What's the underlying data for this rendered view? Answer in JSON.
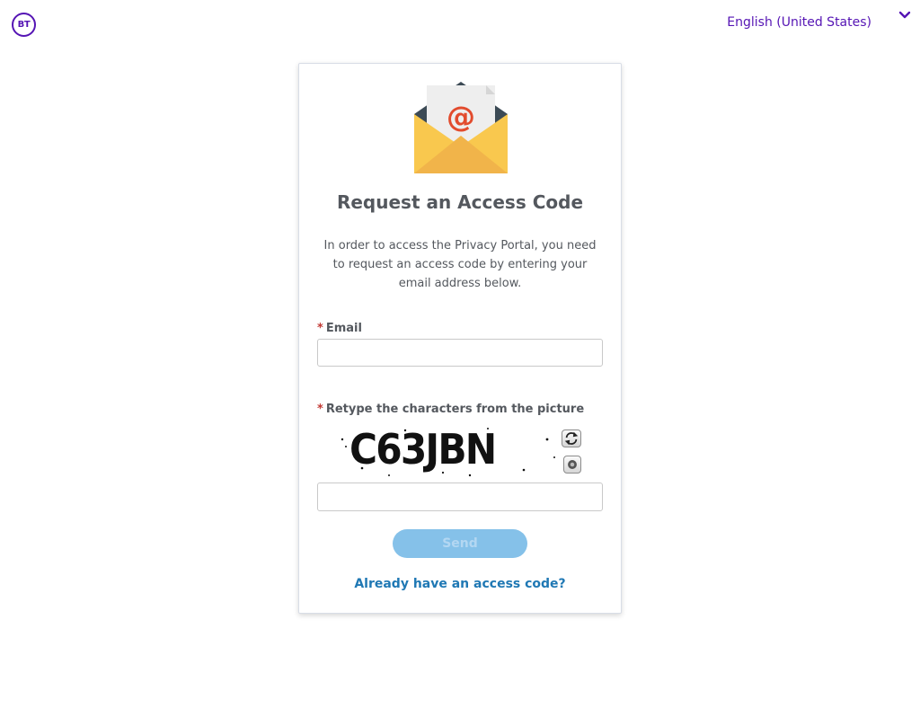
{
  "header": {
    "logo_text": "BT",
    "language": "English (United States)",
    "language_chevron_icon": "chevron-down-icon",
    "brand_color": "#5514b4"
  },
  "card": {
    "hero_icon": "envelope-at-icon",
    "title": "Request an Access Code",
    "intro": "In order to access the Privacy Portal, you need to request an access code by entering your email address below.",
    "required_marker": "*",
    "email_label": "Email",
    "email_value": "",
    "captcha_label": "Retype the characters from the picture",
    "captcha_text": "C63JBN",
    "captcha_refresh_icon": "refresh-icon",
    "captcha_audio_icon": "audio-icon",
    "captcha_value": "",
    "send_label": "Send",
    "already_link": "Already have an access code?"
  },
  "colors": {
    "required": "#c23934",
    "link": "#1f78b4",
    "send_button_disabled": "#85c1e9",
    "text": "#54585e"
  }
}
